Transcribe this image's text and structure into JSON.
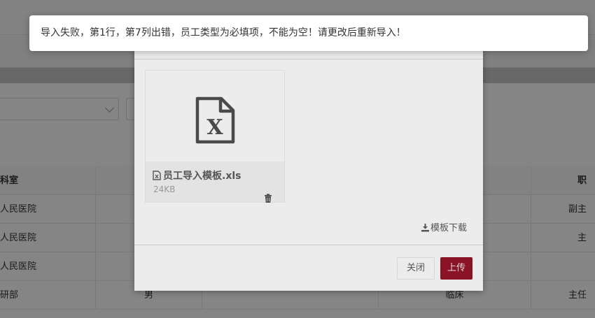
{
  "table": {
    "header": {
      "c1": "科室",
      "c5": "职"
    },
    "rows": [
      {
        "c1": "人民医院",
        "c2": "",
        "c4": "",
        "c5": "副主"
      },
      {
        "c1": "人民医院",
        "c2": "",
        "c4": "",
        "c5": "主"
      },
      {
        "c1": "人民医院",
        "c2": "",
        "c4": "",
        "c5": ""
      },
      {
        "c1": "研部",
        "c2": "男",
        "c4": "临床",
        "c5": "主任"
      }
    ]
  },
  "modal": {
    "file": {
      "name": "员工导入模板.xls",
      "size": "24KB",
      "thumb_icon": "excel-file-icon",
      "name_icon": "file-icon",
      "delete_icon": "trash-icon"
    },
    "template_download": {
      "label": "模板下载",
      "icon": "download-icon"
    },
    "buttons": {
      "close": "关闭",
      "upload": "上传"
    },
    "colors": {
      "upload_button": "#8a1426"
    }
  },
  "toast": {
    "message": "导入失败，第1行，第7列出错，员工类型为必填项，不能为空！请更改后重新导入！"
  }
}
